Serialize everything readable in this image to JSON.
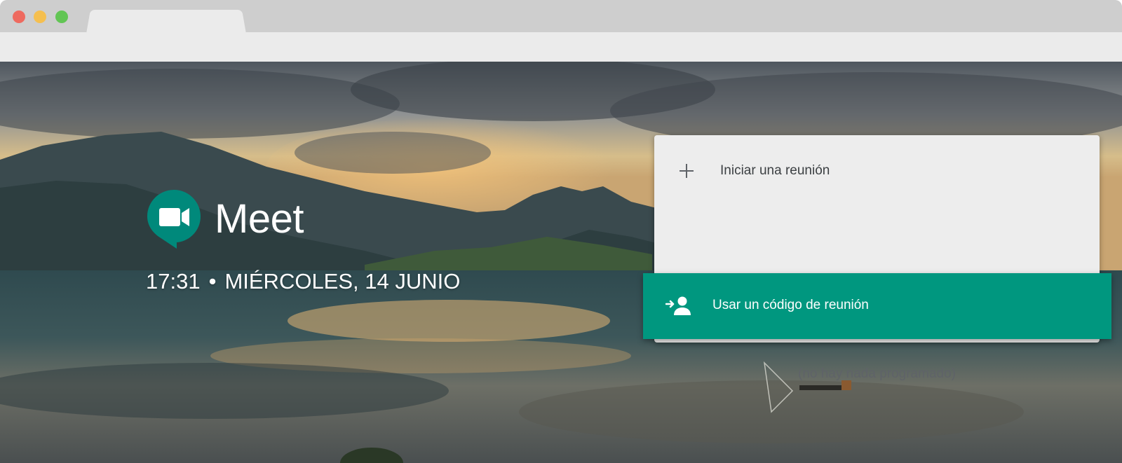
{
  "app": {
    "name": "Meet",
    "colors": {
      "accent": "#00977f",
      "logo_green": "#00897b",
      "card_bg": "#ededed"
    }
  },
  "clock": {
    "time": "17:31",
    "separator": "•",
    "date": "MIÉRCOLES, 14 JUNIO"
  },
  "panel": {
    "start_meeting_label": "Iniciar una reunión",
    "start_meeting_icon": "plus-icon",
    "use_code_label": "Usar un código de reunión",
    "use_code_icon": "person-add-icon",
    "empty_schedule": "(no hay nada programado)"
  }
}
